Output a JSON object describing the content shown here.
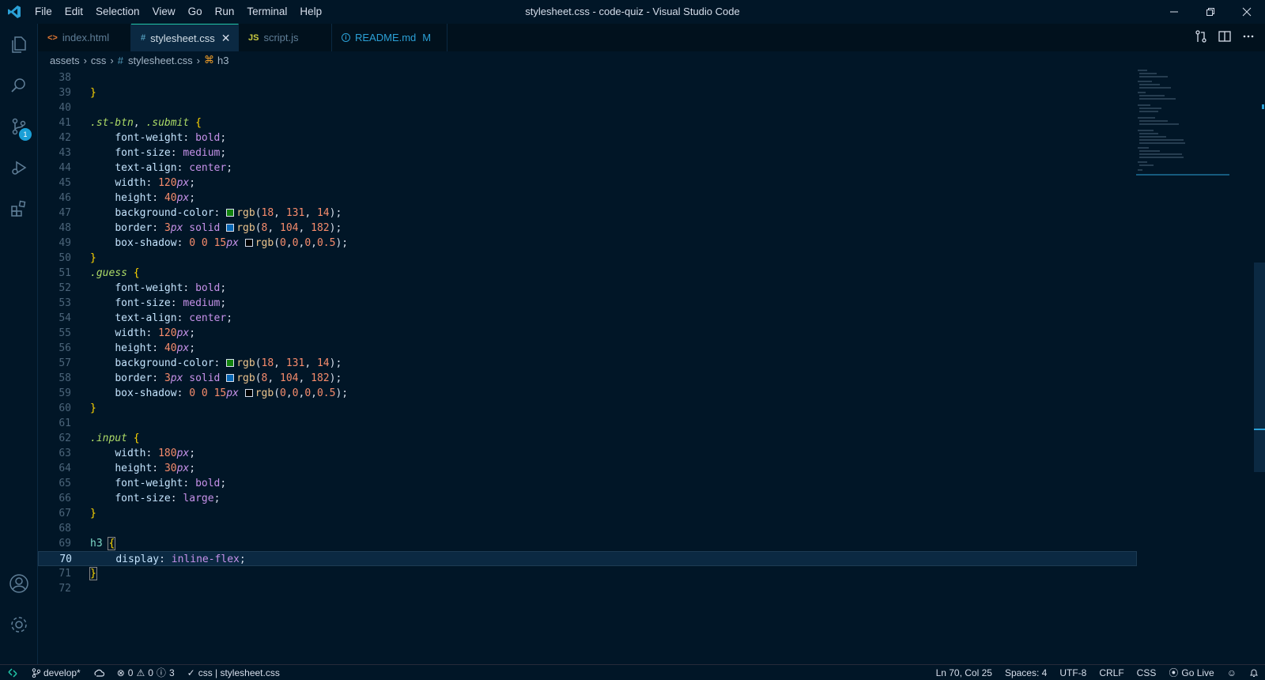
{
  "colors": {
    "background": "#011627",
    "accent": "#21c7a8",
    "badge": "#1a9fd6"
  },
  "menu": [
    "File",
    "Edit",
    "Selection",
    "View",
    "Go",
    "Run",
    "Terminal",
    "Help"
  ],
  "window_title": "stylesheet.css - code-quiz - Visual Studio Code",
  "activity": {
    "badge": "1"
  },
  "tabs": [
    {
      "label": "index.html",
      "icon": "<>"
    },
    {
      "label": "stylesheet.css",
      "icon": "#"
    },
    {
      "label": "script.js",
      "icon": "JS"
    },
    {
      "label": "README.md",
      "icon": "i",
      "status": "M"
    }
  ],
  "breadcrumb": [
    "assets",
    "css",
    "stylesheet.css",
    "h3"
  ],
  "editor": {
    "line_numbers": [
      "38",
      "39",
      "40",
      "41",
      "42",
      "43",
      "44",
      "45",
      "46",
      "47",
      "48",
      "49",
      "50",
      "51",
      "52",
      "53",
      "54",
      "55",
      "56",
      "57",
      "58",
      "59",
      "60",
      "61",
      "62",
      "63",
      "64",
      "65",
      "66",
      "67",
      "68",
      "69",
      "70",
      "71",
      "72"
    ],
    "current_line": "70"
  },
  "status": {
    "branch": "develop*",
    "errors": "0",
    "warnings": "0",
    "info": "3",
    "linters": "css | stylesheet.css",
    "position": "Ln 70, Col 25",
    "spaces": "Spaces: 4",
    "encoding": "UTF-8",
    "eol": "CRLF",
    "language": "CSS",
    "golive": "Go Live"
  }
}
